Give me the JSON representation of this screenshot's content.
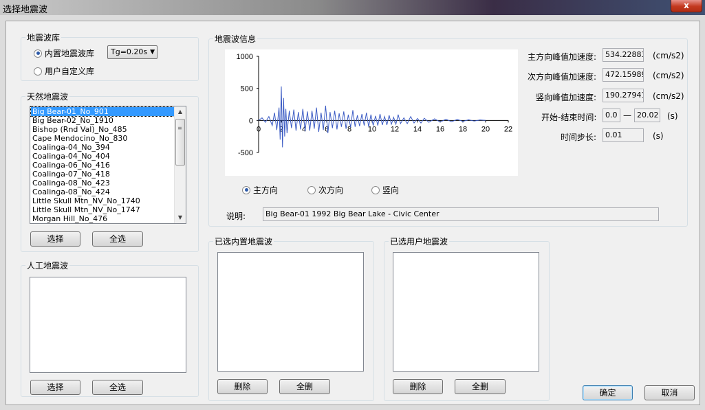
{
  "window": {
    "title": "选择地震波",
    "close_glyph": "x"
  },
  "library": {
    "legend": "地震波库",
    "builtin_label": "内置地震波库",
    "custom_label": "用户自定义库",
    "tg_value": "Tg=0.20s"
  },
  "natural": {
    "legend": "天然地震波",
    "items": [
      "Big Bear-01_No_901",
      "Big Bear-02_No_1910",
      "Bishop (Rnd Val)_No_485",
      "Cape Mendocino_No_830",
      "Coalinga-04_No_394",
      "Coalinga-04_No_404",
      "Coalinga-06_No_416",
      "Coalinga-07_No_418",
      "Coalinga-08_No_423",
      "Coalinga-08_No_424",
      "Little Skull Mtn_NV_No_1740",
      "Little Skull Mtn_NV_No_1747",
      "Morgan Hill_No_476"
    ],
    "select_button": "选择",
    "select_all_button": "全选"
  },
  "artificial": {
    "legend": "人工地震波",
    "select_button": "选择",
    "select_all_button": "全选"
  },
  "info": {
    "legend": "地震波信息",
    "direction_main": "主方向",
    "direction_secondary": "次方向",
    "direction_vertical": "竖向",
    "desc_label": "说明:",
    "desc_value": "Big Bear-01 1992 Big Bear Lake - Civic Center",
    "pga_main_label": "主方向峰值加速度:",
    "pga_main_value": "534.22883",
    "pga_secondary_label": "次方向峰值加速度:",
    "pga_secondary_value": "472.15989",
    "pga_vertical_label": "竖向峰值加速度:",
    "pga_vertical_value": "190.27941",
    "unit_acc": "(cm/s2)",
    "time_label": "开始-结束时间:",
    "time_start": "0.0",
    "time_dash": "—",
    "time_end": "20.02",
    "unit_s": "(s)",
    "step_label": "时间步长:",
    "step_value": "0.01"
  },
  "selected_builtin": {
    "legend": "已选内置地震波",
    "delete_button": "删除",
    "delete_all_button": "全删"
  },
  "selected_user": {
    "legend": "已选用户地震波",
    "delete_button": "删除",
    "delete_all_button": "全删"
  },
  "footer": {
    "ok_button": "确定",
    "cancel_button": "取消"
  },
  "chart_data": {
    "type": "line",
    "title": "",
    "xlabel": "",
    "ylabel": "",
    "xlim": [
      0,
      22
    ],
    "ylim": [
      -500,
      1000
    ],
    "xticks": [
      0,
      2,
      4,
      6,
      8,
      10,
      12,
      14,
      16,
      18,
      20,
      22
    ],
    "yticks": [
      1000,
      500,
      0,
      -500
    ],
    "grid": false,
    "color": "#3b5bc4",
    "series": [
      {
        "x": [
          0,
          0.3,
          0.6,
          0.9,
          1.2,
          1.4,
          1.6,
          1.8,
          1.9,
          2.0,
          2.1,
          2.2,
          2.3,
          2.4,
          2.5,
          2.7,
          2.9,
          3.1,
          3.3,
          3.5,
          3.7,
          3.9,
          4.1,
          4.3,
          4.5,
          4.7,
          4.9,
          5.1,
          5.3,
          5.5,
          5.7,
          5.9,
          6.1,
          6.3,
          6.5,
          6.7,
          6.9,
          7.1,
          7.3,
          7.5,
          7.7,
          7.9,
          8.1,
          8.3,
          8.5,
          8.7,
          8.9,
          9.1,
          9.3,
          9.5,
          9.7,
          9.9,
          10.1,
          10.3,
          10.5,
          10.7,
          10.9,
          11.1,
          11.3,
          11.5,
          11.7,
          11.9,
          12.1,
          12.3,
          12.5,
          12.8,
          13.1,
          13.4,
          13.7,
          14.0,
          14.3,
          14.6,
          15.0,
          15.5,
          16.0,
          16.5,
          17.0,
          17.5,
          18.0,
          18.5,
          19.0,
          19.5,
          20.0
        ],
        "y": [
          0,
          40,
          -30,
          60,
          -80,
          120,
          -150,
          200,
          -300,
          530,
          -420,
          350,
          -250,
          180,
          -200,
          150,
          -120,
          170,
          -160,
          130,
          -140,
          180,
          -170,
          140,
          -160,
          150,
          -130,
          200,
          -180,
          120,
          -150,
          230,
          -200,
          130,
          -120,
          150,
          -140,
          110,
          -100,
          140,
          -130,
          90,
          -110,
          160,
          -100,
          80,
          -90,
          100,
          -80,
          120,
          -100,
          90,
          -80,
          70,
          -80,
          100,
          -70,
          60,
          -70,
          80,
          -60,
          50,
          -60,
          90,
          -50,
          40,
          -50,
          60,
          -40,
          30,
          -40,
          35,
          -30,
          25,
          -25,
          20,
          -20,
          15,
          -15,
          10,
          -10,
          8,
          0
        ]
      }
    ]
  }
}
